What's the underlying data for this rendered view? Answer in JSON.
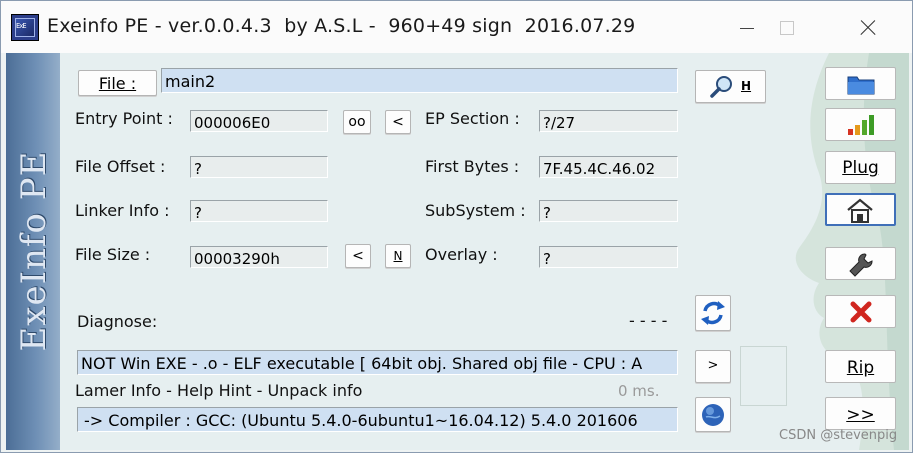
{
  "window": {
    "title": "Exeinfo PE - ver.0.0.4.3  by A.S.L -  960+49 sign  2016.07.29",
    "icon_text": "ExE",
    "vertical_title": "ExeInfo PE"
  },
  "file": {
    "button_label": "File :",
    "value": "main2",
    "search_button_label": "H"
  },
  "fields": {
    "entry_point_label": "Entry Point :",
    "entry_point_value": "000006E0",
    "entry_oo_label": "oo",
    "entry_lt_label": "<",
    "ep_section_label": "EP Section :",
    "ep_section_value": "?/27",
    "file_offset_label": "File Offset :",
    "file_offset_value": "?",
    "first_bytes_label": "First Bytes :",
    "first_bytes_value": "7F.45.4C.46.02",
    "linker_info_label": "Linker Info :",
    "linker_info_value": "?",
    "subsystem_label": "SubSystem :",
    "subsystem_value": "?",
    "file_size_label": "File Size :",
    "file_size_value": "00003290h",
    "size_lt_label": "<",
    "size_n_label": "N",
    "overlay_label": "Overlay :",
    "overlay_value": "?"
  },
  "diagnose": {
    "label": "Diagnose:",
    "dashes": "- - - -",
    "result": "NOT Win EXE - .o - ELF executable [ 64bit obj. Shared obj file - CPU : A",
    "more_button": ">",
    "lamer_label": "Lamer Info - Help Hint - Unpack info",
    "time": "0 ms.",
    "compiler": "-> Compiler : GCC: (Ubuntu 5.4.0-6ubuntu1~16.04.12) 5.4.0 201606"
  },
  "sidebar_buttons": {
    "plug": "Plug",
    "rip": "Rip",
    "next": ">>"
  },
  "watermark": "CSDN @stevenpig",
  "colors": {
    "accent_blue": "#3f6fb8",
    "field_blue": "#cfe0f2",
    "close_red": "#d0261f"
  },
  "icons": [
    "folder-icon",
    "signal-bars-icon",
    "home-icon",
    "wrench-icon",
    "red-x-icon",
    "refresh-icon",
    "globe-icon",
    "magnifier-icon"
  ]
}
